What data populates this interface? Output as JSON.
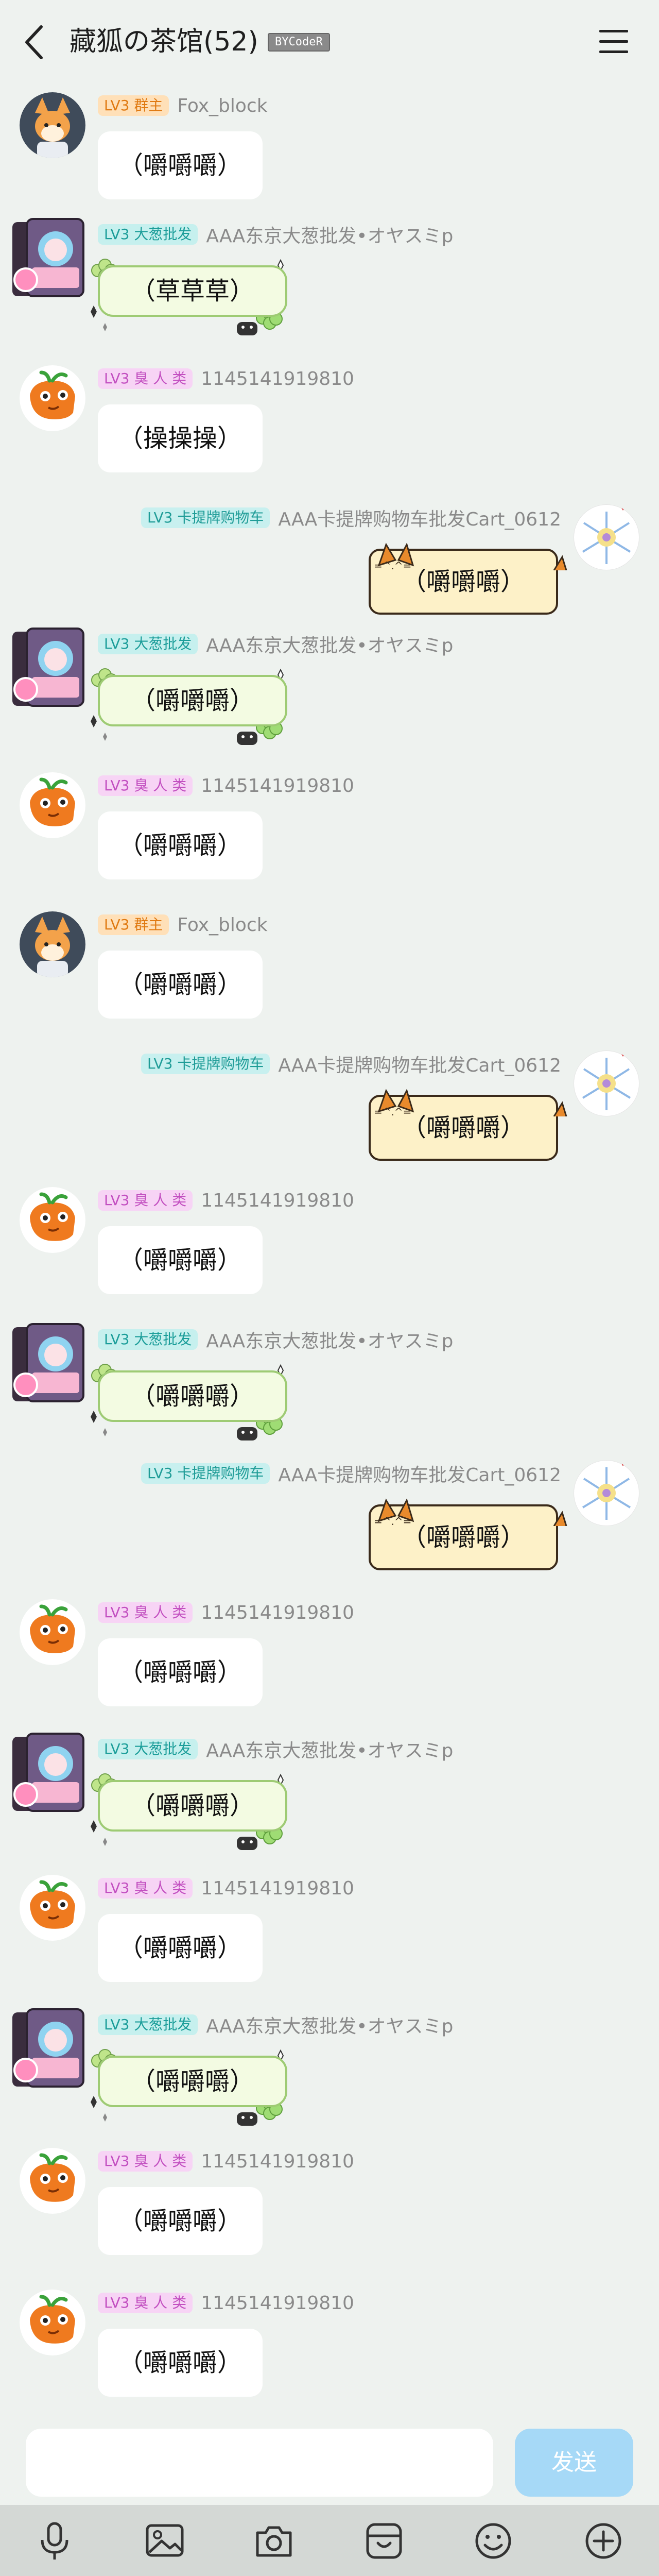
{
  "header": {
    "title": "藏狐の茶馆(52)",
    "badge": "BYCodeR"
  },
  "input": {
    "placeholder": "",
    "send_label": "发送"
  },
  "toolbar": [
    "mic-icon",
    "image-icon",
    "camera-icon",
    "sticker-icon",
    "emoji-icon",
    "plus-icon"
  ],
  "colors": {
    "background": "#eef2ef",
    "send_button": "#a6d9f7",
    "toolbar": "#d4d8d5"
  },
  "messages": [
    {
      "side": "left",
      "avatar": "fox",
      "badge": "LV3 群主",
      "badge_type": "owner",
      "name": "Fox_block",
      "text": "（嚼嚼嚼）",
      "style": "plain"
    },
    {
      "side": "left",
      "avatar": "card",
      "badge": "LV3 大葱批发",
      "badge_type": "dacong",
      "name": "AAA东京大葱批发•オヤスミp",
      "text": "（草草草）",
      "style": "green"
    },
    {
      "side": "left",
      "avatar": "orange",
      "badge": "LV3 臭 人 类",
      "badge_type": "chouren",
      "name": "1145141919810",
      "text": "（操操操）",
      "style": "plain"
    },
    {
      "side": "right",
      "avatar": "flower",
      "badge": "LV3 卡提牌购物车",
      "badge_type": "kati",
      "name": "AAA卡提牌购物车批发Cart_0612",
      "text": "（嚼嚼嚼）",
      "style": "cat"
    },
    {
      "side": "left",
      "avatar": "card",
      "badge": "LV3 大葱批发",
      "badge_type": "dacong",
      "name": "AAA东京大葱批发•オヤスミp",
      "text": "（嚼嚼嚼）",
      "style": "green"
    },
    {
      "side": "left",
      "avatar": "orange",
      "badge": "LV3 臭 人 类",
      "badge_type": "chouren",
      "name": "1145141919810",
      "text": "（嚼嚼嚼）",
      "style": "plain"
    },
    {
      "side": "left",
      "avatar": "fox",
      "badge": "LV3 群主",
      "badge_type": "owner",
      "name": "Fox_block",
      "text": "（嚼嚼嚼）",
      "style": "plain"
    },
    {
      "side": "right",
      "avatar": "flower",
      "badge": "LV3 卡提牌购物车",
      "badge_type": "kati",
      "name": "AAA卡提牌购物车批发Cart_0612",
      "text": "（嚼嚼嚼）",
      "style": "cat"
    },
    {
      "side": "left",
      "avatar": "orange",
      "badge": "LV3 臭 人 类",
      "badge_type": "chouren",
      "name": "1145141919810",
      "text": "（嚼嚼嚼）",
      "style": "plain"
    },
    {
      "side": "left",
      "avatar": "card",
      "badge": "LV3 大葱批发",
      "badge_type": "dacong",
      "name": "AAA东京大葱批发•オヤスミp",
      "text": "（嚼嚼嚼）",
      "style": "green"
    },
    {
      "side": "right",
      "avatar": "flower",
      "badge": "LV3 卡提牌购物车",
      "badge_type": "kati",
      "name": "AAA卡提牌购物车批发Cart_0612",
      "text": "（嚼嚼嚼）",
      "style": "cat"
    },
    {
      "side": "left",
      "avatar": "orange",
      "badge": "LV3 臭 人 类",
      "badge_type": "chouren",
      "name": "1145141919810",
      "text": "（嚼嚼嚼）",
      "style": "plain"
    },
    {
      "side": "left",
      "avatar": "card",
      "badge": "LV3 大葱批发",
      "badge_type": "dacong",
      "name": "AAA东京大葱批发•オヤスミp",
      "text": "（嚼嚼嚼）",
      "style": "green"
    },
    {
      "side": "left",
      "avatar": "orange",
      "badge": "LV3 臭 人 类",
      "badge_type": "chouren",
      "name": "1145141919810",
      "text": "（嚼嚼嚼）",
      "style": "plain"
    },
    {
      "side": "left",
      "avatar": "card",
      "badge": "LV3 大葱批发",
      "badge_type": "dacong",
      "name": "AAA东京大葱批发•オヤスミp",
      "text": "（嚼嚼嚼）",
      "style": "green"
    },
    {
      "side": "left",
      "avatar": "orange",
      "badge": "LV3 臭 人 类",
      "badge_type": "chouren",
      "name": "1145141919810",
      "text": "（嚼嚼嚼）",
      "style": "plain"
    },
    {
      "side": "left",
      "avatar": "orange",
      "badge": "LV3 臭 人 类",
      "badge_type": "chouren",
      "name": "1145141919810",
      "text": "（嚼嚼嚼）",
      "style": "plain"
    }
  ]
}
